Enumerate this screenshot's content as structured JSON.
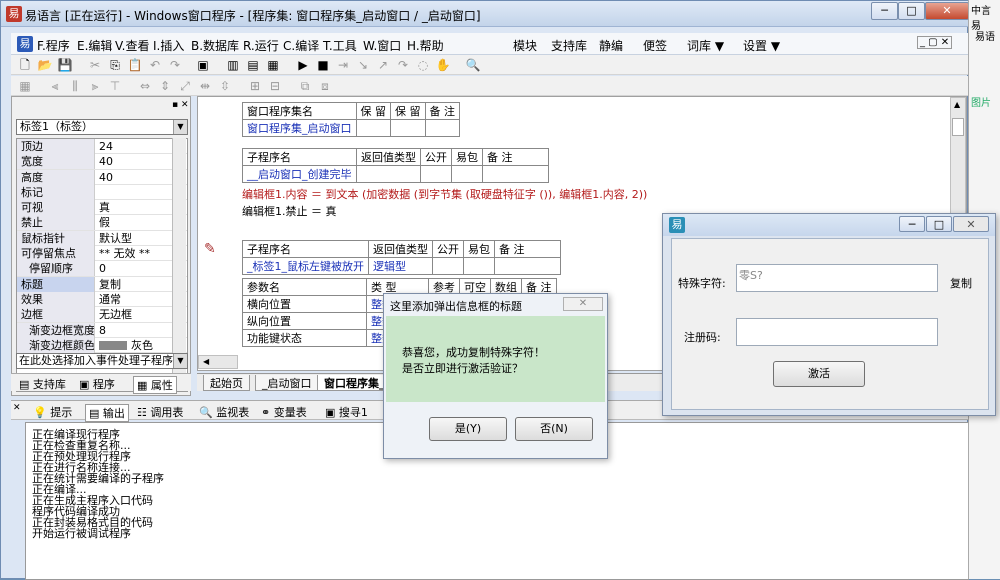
{
  "window": {
    "title": "易语言 [正在运行] - Windows窗口程序 - [程序集: 窗口程序集_启动窗口 / _启动窗口]",
    "icon": "yi-logo-icon"
  },
  "menu": [
    "F.程序",
    "E.编辑",
    "V.查看",
    "I.插入",
    "B.数据库",
    "R.运行",
    "C.编译",
    "T.工具",
    "W.窗口",
    "H.帮助",
    "模块",
    "支持库",
    "静编",
    "便签",
    "词库 ▼",
    "设置 ▼"
  ],
  "left_panel": {
    "combo": "标签1（标签）",
    "properties": [
      {
        "name": "顶边",
        "value": "24"
      },
      {
        "name": "宽度",
        "value": "40"
      },
      {
        "name": "高度",
        "value": "40"
      },
      {
        "name": "标记",
        "value": ""
      },
      {
        "name": "可视",
        "value": "真"
      },
      {
        "name": "禁止",
        "value": "假"
      },
      {
        "name": "鼠标指针",
        "value": "默认型"
      },
      {
        "name": "可停留焦点",
        "value": "** 无效 **"
      },
      {
        "name": "停留顺序",
        "value": "0"
      },
      {
        "name": "标题",
        "value": "复制"
      },
      {
        "name": "效果",
        "value": "通常"
      },
      {
        "name": "边框",
        "value": "无边框"
      },
      {
        "name": "渐变边框宽度",
        "value": "8"
      },
      {
        "name": "渐变边框颜色",
        "value": "灰色"
      }
    ],
    "event_combo": "在此处选择加入事件处理子程序",
    "tabs": [
      "支持库",
      "程序",
      "属性"
    ]
  },
  "editor": {
    "set_table": {
      "headers": [
        "窗口程序集名",
        "保 留",
        "保 留",
        "备 注"
      ],
      "row": [
        "窗口程序集_启动窗口",
        "",
        "",
        ""
      ]
    },
    "sub1": {
      "headers": [
        "子程序名",
        "返回值类型",
        "公开",
        "易包",
        "备 注"
      ],
      "row": [
        "__启动窗口_创建完毕",
        "",
        "",
        "",
        ""
      ]
    },
    "code1": "编辑框1.内容 ＝ 到文本 (加密数据 (到字节集 (取硬盘特征字 ()), 编辑框1.内容, 2))",
    "code2": "编辑框1.禁止 ＝ 真",
    "sub2": {
      "headers": [
        "子程序名",
        "返回值类型",
        "公开",
        "易包",
        "备 注"
      ],
      "row": [
        "_标签1_鼠标左键被放开",
        "逻辑型",
        "",
        "",
        ""
      ]
    },
    "params": {
      "headers": [
        "参数名",
        "类 型",
        "参考",
        "可空",
        "数组",
        "备 注"
      ],
      "rows": [
        [
          "横向位置",
          "整数型"
        ],
        [
          "纵向位置",
          "整数型"
        ],
        [
          "功能键状态",
          "整数型"
        ]
      ]
    },
    "tabs": [
      "起始页",
      "_启动窗口",
      "窗口程序集_"
    ]
  },
  "bottom_tabs": [
    "提示",
    "输出",
    "调用表",
    "监视表",
    "变量表",
    "搜寻1"
  ],
  "output_lines": [
    "正在编译现行程序",
    "正在检查重复名称...",
    "正在预处理现行程序",
    "正在进行名称连接...",
    "正在统计需要编译的子程序",
    "正在编译...",
    "正在生成主程序入口代码",
    "程序代码编译成功",
    "正在封装易格式目的代码",
    "开始运行被调试程序"
  ],
  "msgbox": {
    "caption": "这里添加弹出信息框的标题",
    "line1": "恭喜您，成功复制特殊字符！",
    "line2": "是否立即进行激活验证？",
    "yes": "是(Y)",
    "no": "否(N)"
  },
  "reg_dialog": {
    "label_special": "特殊字符:",
    "special_value": "零S?",
    "copy": "复制",
    "label_code": "注册码:",
    "code_value": "",
    "activate": "激活"
  },
  "right_edge": {
    "text1": "中言易",
    "text2": "易语",
    "text3": "图片"
  },
  "colors": {
    "accent": "#1a31b7",
    "msg_body": "#c9e6c9"
  }
}
